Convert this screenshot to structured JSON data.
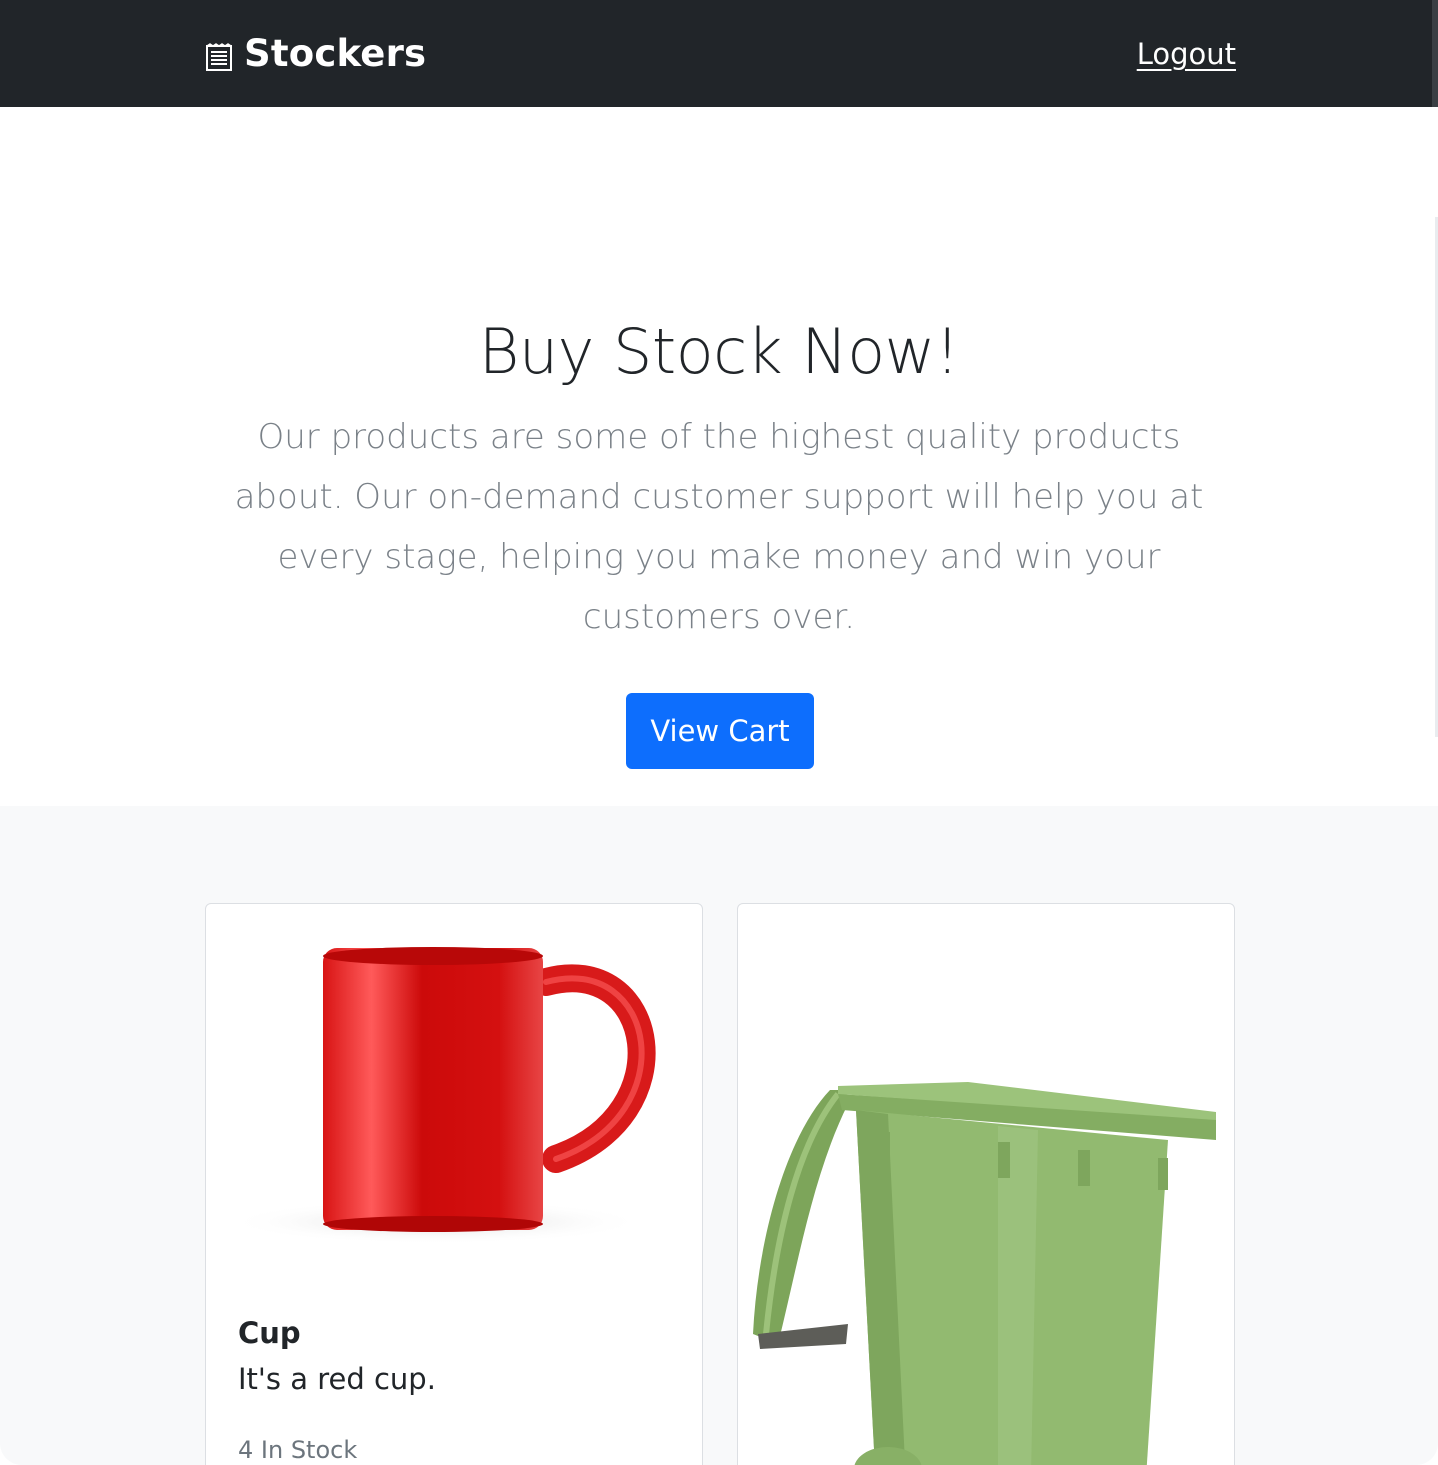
{
  "navbar": {
    "brand": "Stockers",
    "brand_icon": "receipt-icon",
    "logout_label": "Logout",
    "background": "#212529"
  },
  "hero": {
    "title": "Buy Stock Now!",
    "lead": "Our products are some of the highest quality products about. Our on-demand customer support will help you at every stage, helping you make money and win your customers over.",
    "cart_button_label": "View Cart",
    "accent": "#0d6efd"
  },
  "products": [
    {
      "name": "Cup",
      "description": "It's a red cup.",
      "stock": "4 In Stock",
      "image": "red-mug-image"
    },
    {
      "name": "",
      "description": "",
      "stock": "",
      "image": "green-bin-image"
    }
  ]
}
